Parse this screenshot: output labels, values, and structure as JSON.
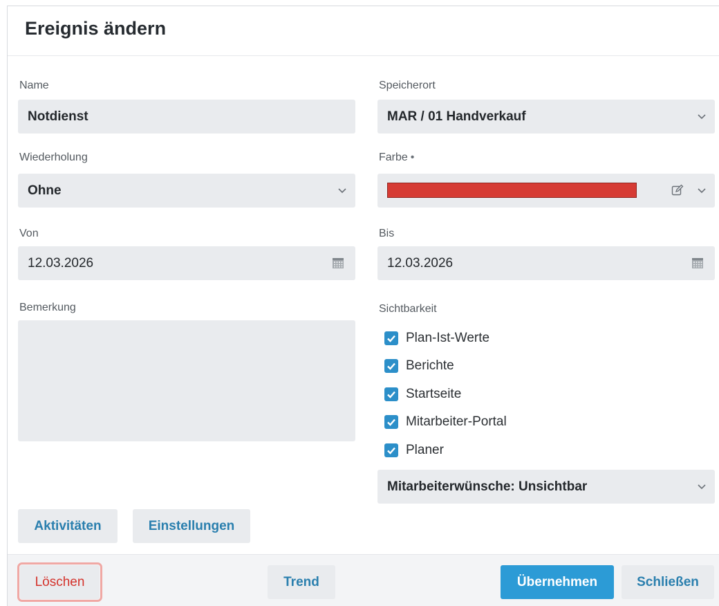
{
  "dialog": {
    "title": "Ereignis ändern"
  },
  "form": {
    "name": {
      "label": "Name",
      "value": "Notdienst"
    },
    "location": {
      "label": "Speicherort",
      "value": "MAR / 01 Handverkauf"
    },
    "repeat": {
      "label": "Wiederholung",
      "value": "Ohne"
    },
    "color": {
      "label": "Farbe",
      "required_mark": "•",
      "value": "#d63b34"
    },
    "from": {
      "label": "Von",
      "value": "12.03.2026"
    },
    "to": {
      "label": "Bis",
      "value": "12.03.2026"
    },
    "remark": {
      "label": "Bemerkung",
      "value": ""
    },
    "visibility": {
      "label": "Sichtbarkeit",
      "options": [
        {
          "label": "Plan-Ist-Werte",
          "checked": true
        },
        {
          "label": "Berichte",
          "checked": true
        },
        {
          "label": "Startseite",
          "checked": true
        },
        {
          "label": "Mitarbeiter-Portal",
          "checked": true
        },
        {
          "label": "Planer",
          "checked": true
        }
      ],
      "employee_wishes": "Mitarbeiterwünsche: Unsichtbar"
    }
  },
  "actions": {
    "activities": "Aktivitäten",
    "settings": "Einstellungen",
    "delete": "Löschen",
    "trend": "Trend",
    "apply": "Übernehmen",
    "close": "Schließen"
  }
}
